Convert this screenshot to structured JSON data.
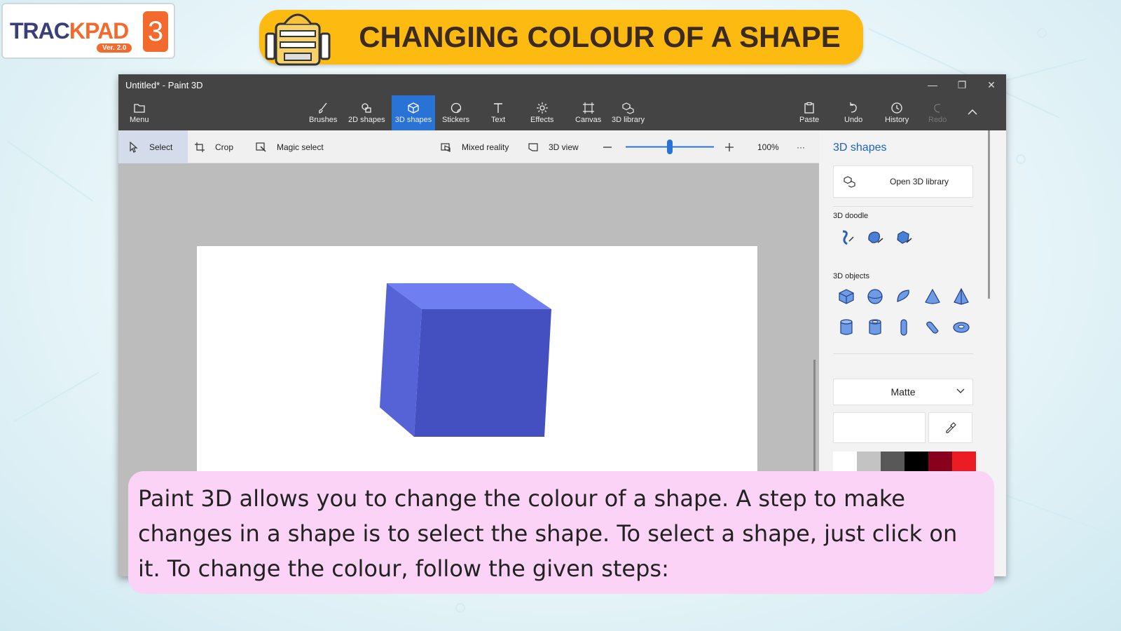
{
  "logo": {
    "text_a": "TRAC",
    "text_b": "KPAD",
    "version": "Ver. 2.0",
    "number": "3"
  },
  "banner": {
    "title": "CHANGING COLOUR OF A SHAPE"
  },
  "window": {
    "title": "Untitled* - Paint 3D",
    "ribbon": {
      "menu": "Menu",
      "brushes": "Brushes",
      "shapes2d": "2D shapes",
      "shapes3d": "3D shapes",
      "stickers": "Stickers",
      "text": "Text",
      "effects": "Effects",
      "canvas": "Canvas",
      "library3d": "3D library",
      "paste": "Paste",
      "undo": "Undo",
      "history": "History",
      "redo": "Redo"
    },
    "toolbar": {
      "select": "Select",
      "crop": "Crop",
      "magic_select": "Magic select",
      "mixed_reality": "Mixed reality",
      "view3d": "3D view",
      "zoom": "100%",
      "zoom_level": 0.5,
      "more": "···"
    },
    "panel": {
      "title": "3D shapes",
      "open_library": "Open 3D library",
      "doodle_label": "3D doodle",
      "objects_label": "3D objects",
      "material": "Matte",
      "swatches": [
        "#ffffff",
        "#c3c3c3",
        "#585858",
        "#000000",
        "#88001b",
        "#ec1c24"
      ]
    },
    "accent": "#2a73d6",
    "cube_color": "#4450c0"
  },
  "caption": {
    "text": "Paint 3D allows you to change the colour of a shape. A step to make changes in a shape is to select the shape. To select a shape, just click on it. To change the colour, follow the given steps:"
  }
}
